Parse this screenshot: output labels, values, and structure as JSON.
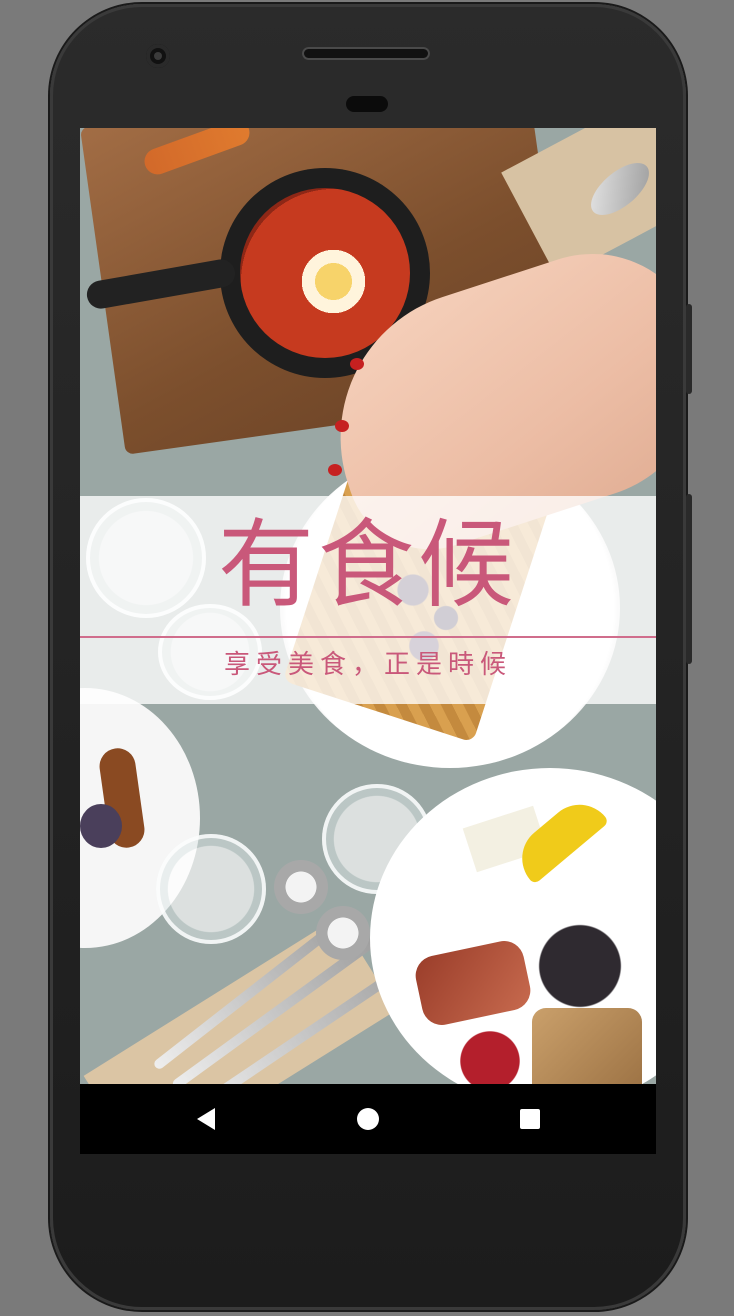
{
  "app": {
    "title": "有食候",
    "tagline": "享受美食，正是時候"
  },
  "colors": {
    "brand_pink": "#c9587a",
    "nav_bar_bg": "#000000",
    "device_frame": "#1c1c1c"
  },
  "navigation_bar": {
    "back_icon": "back-triangle-icon",
    "home_icon": "home-circle-icon",
    "recents_icon": "recents-square-icon"
  }
}
